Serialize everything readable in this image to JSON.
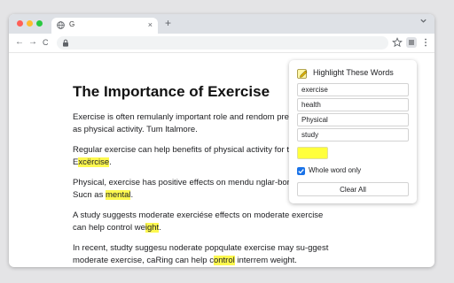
{
  "browser": {
    "tab_title": "G",
    "newtab_label": "+",
    "tab_close_label": "×",
    "nav": {
      "back": "←",
      "forward": "→",
      "reload": "C"
    },
    "window_controls": [
      "close",
      "minimize",
      "zoom"
    ]
  },
  "article": {
    "title": "The Importance of Exercise",
    "paragraphs": [
      [
        {
          "t": "Exercise is often remulanly important role and rendom preventing such as physical activity. Tum ltalmore."
        }
      ],
      [
        {
          "t": "Regular exercise can help benefits of physical activity for the body. E"
        },
        {
          "t": "xcërcise",
          "hl": true
        },
        {
          "t": "."
        }
      ],
      [
        {
          "t": "Physical, exercise has positive effects on mendu nglar-bor l'welbeing. Sucn as "
        },
        {
          "t": "mental",
          "hl": true
        },
        {
          "t": "."
        }
      ],
      [
        {
          "t": "A study suggests moderate exerciése effects on moderate exercise can help control we"
        },
        {
          "t": "ight",
          "hl": true
        },
        {
          "t": "."
        }
      ],
      [
        {
          "t": "In recent, studty suggesu noderate popqulate exercise may su-ggest moderate exercise, caRing can help c"
        },
        {
          "t": "ontrol",
          "hl": true
        },
        {
          "t": " interrem weight."
        }
      ]
    ]
  },
  "extension_popup": {
    "title": "Highlight These Words",
    "words": [
      "exercise",
      "health",
      "Physical",
      "study"
    ],
    "highlight_color": "#ffff3b",
    "whole_word_label": "Whole word only",
    "whole_word_checked": true,
    "clear_button_label": "Clear All"
  },
  "colors": {
    "highlight": "#fdf84f",
    "accent": "#1a73e8"
  }
}
